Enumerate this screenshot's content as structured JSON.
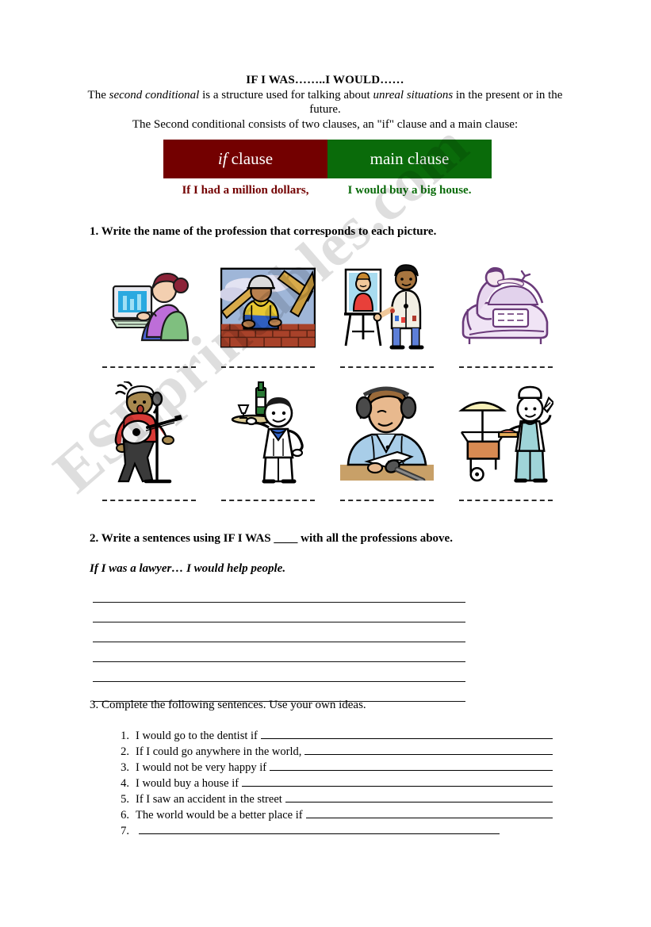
{
  "document": {
    "title": "IF I WAS……..I WOULD……",
    "intro_part1": "The ",
    "intro_em1": "second conditional",
    "intro_part2": " is a structure used for talking about ",
    "intro_em2": "unreal situations",
    "intro_part3": " in the present or in the future.",
    "intro_line2": "The Second conditional consists of two clauses, an \"if\" clause and a main clause:"
  },
  "clause_table": {
    "if_label_em": "if",
    "if_label_rest": "clause",
    "main_label": "main clause",
    "if_color": "#730000",
    "main_color": "#0a6b0a",
    "example_if": "If I had a million dollars,",
    "example_main": "I would buy a big house."
  },
  "exercise1": {
    "heading": "1. Write the name of the profession that corresponds to each picture.",
    "pictures_row1": [
      {
        "icon": "secretary-at-computer-icon",
        "answer_line": ""
      },
      {
        "icon": "construction-worker-icon",
        "answer_line": ""
      },
      {
        "icon": "painter-artist-icon",
        "answer_line": ""
      },
      {
        "icon": "car-mechanic-icon",
        "answer_line": ""
      }
    ],
    "pictures_row2": [
      {
        "icon": "singer-guitarist-icon",
        "answer_line": ""
      },
      {
        "icon": "waiter-with-tray-icon",
        "answer_line": ""
      },
      {
        "icon": "radio-announcer-icon",
        "answer_line": ""
      },
      {
        "icon": "street-food-cook-icon",
        "answer_line": ""
      }
    ]
  },
  "exercise2": {
    "heading": "2. Write a sentences using IF I WAS ____ with all the professions above.",
    "example": "If I was a lawyer… I would help people.",
    "blank_line_count": 6
  },
  "exercise3": {
    "heading": "3. Complete the following sentences. Use your own ideas.",
    "items": [
      {
        "num": "1.",
        "text": "I would go to the dentist if"
      },
      {
        "num": "2.",
        "text": "If I could go anywhere in the world,"
      },
      {
        "num": "3.",
        "text": "I would not be very happy if"
      },
      {
        "num": "4.",
        "text": "I would buy a house if"
      },
      {
        "num": "5.",
        "text": "If I saw an accident in the street"
      },
      {
        "num": "6.",
        "text": "The world would be a better place if"
      },
      {
        "num": "7.",
        "text": ""
      }
    ]
  },
  "watermark": {
    "text": "ESLprintables.com"
  }
}
